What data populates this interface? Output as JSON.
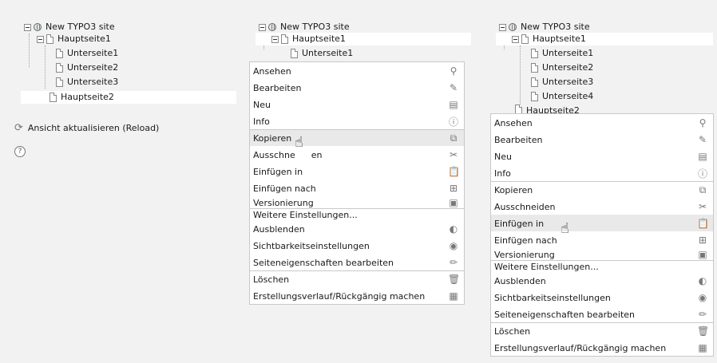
{
  "tree": {
    "root": "New TYPO3 site",
    "page1": "Hauptseite1",
    "sub1": "Unterseite1",
    "sub2": "Unterseite2",
    "sub3": "Unterseite3",
    "sub4": "Unterseite4",
    "page2": "Hauptseite2"
  },
  "reload_label": "Ansicht aktualisieren (Reload)",
  "help_symbol": "?",
  "menu": {
    "items": [
      {
        "label": "Ansehen",
        "icon": "magnifier-icon"
      },
      {
        "label": "Bearbeiten",
        "icon": "edit-icon"
      },
      {
        "label": "Neu",
        "icon": "new-page-icon"
      },
      {
        "label": "Info",
        "icon": "info-icon"
      },
      {
        "label": "Kopieren",
        "icon": "copy-icon"
      },
      {
        "label": "Ausschneiden",
        "icon": "scissors-icon"
      },
      {
        "label": "Einfügen in",
        "icon": "paste-into-icon"
      },
      {
        "label": "Einfügen nach",
        "icon": "paste-after-icon"
      },
      {
        "label": "Versionierung",
        "icon": "versioning-icon"
      },
      {
        "label": "Weitere Einstellungen...",
        "icon": ""
      },
      {
        "label": "Ausblenden",
        "icon": "hide-icon"
      },
      {
        "label": "Sichtbarkeitseinstellungen",
        "icon": "visibility-icon"
      },
      {
        "label": "Seiteneigenschaften bearbeiten",
        "icon": "pencil-icon"
      },
      {
        "label": "Löschen",
        "icon": "trash-icon"
      },
      {
        "label": "Erstellungsverlauf/Rückgängig machen",
        "icon": "history-icon"
      }
    ]
  },
  "menu1_partial_label": "Ausschne",
  "menu1_partial_label_end": "en"
}
